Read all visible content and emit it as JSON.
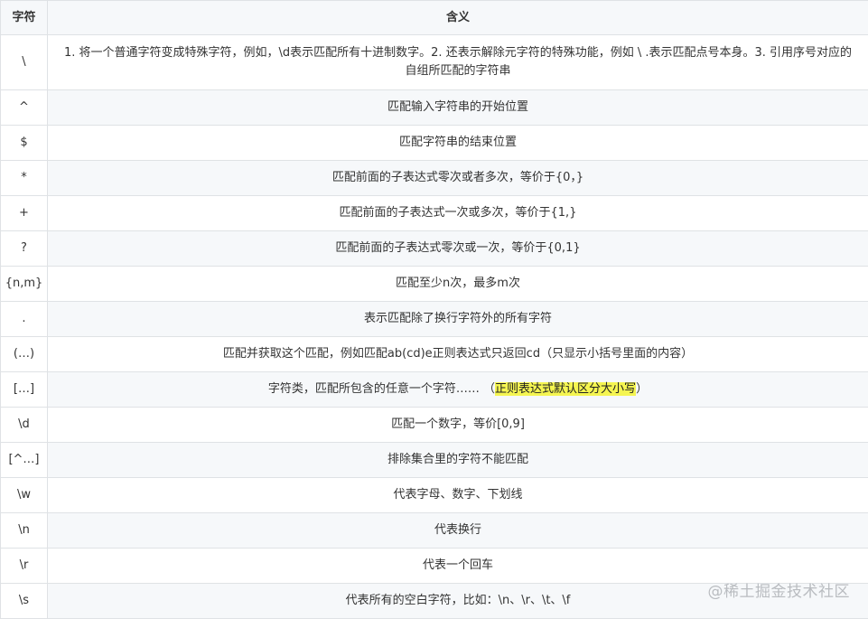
{
  "table": {
    "headers": [
      "字符",
      "含义"
    ],
    "rows": [
      {
        "char": "\\",
        "meaning": "1. 将一个普通字符变成特殊字符，例如，\\d表示匹配所有十进制数字。2. 还表示解除元字符的特殊功能，例如 \\ .表示匹配点号本身。3. 引用序号对应的自组所匹配的字符串",
        "highlight": ""
      },
      {
        "char": "^",
        "meaning": "匹配输入字符串的开始位置",
        "highlight": ""
      },
      {
        "char": "$",
        "meaning": "匹配字符串的结束位置",
        "highlight": ""
      },
      {
        "char": "*",
        "meaning": "匹配前面的子表达式零次或者多次，等价于{0，}",
        "highlight": ""
      },
      {
        "char": "+",
        "meaning": "匹配前面的子表达式一次或多次，等价于{1,}",
        "highlight": ""
      },
      {
        "char": "?",
        "meaning": "匹配前面的子表达式零次或一次，等价于{0,1}",
        "highlight": ""
      },
      {
        "char": "{n,m}",
        "meaning": "匹配至少n次，最多m次",
        "highlight": ""
      },
      {
        "char": ".",
        "meaning": "表示匹配除了换行字符外的所有字符",
        "highlight": ""
      },
      {
        "char": "(…)",
        "meaning": "匹配并获取这个匹配，例如匹配ab(cd)e正则表达式只返回cd（只显示小括号里面的内容）",
        "highlight": ""
      },
      {
        "char": "[…]",
        "meaning": "字符类，匹配所包含的任意一个字符…… （",
        "highlight": "正则表达式默认区分大小写",
        "meaning_after": "）"
      },
      {
        "char": "\\d",
        "meaning": "匹配一个数字，等价[0,9]",
        "highlight": ""
      },
      {
        "char": "[^…]",
        "meaning": "排除集合里的字符不能匹配",
        "highlight": ""
      },
      {
        "char": "\\w",
        "meaning": "代表字母、数字、下划线",
        "highlight": ""
      },
      {
        "char": "\\n",
        "meaning": "代表换行",
        "highlight": ""
      },
      {
        "char": "\\r",
        "meaning": "代表一个回车",
        "highlight": ""
      },
      {
        "char": "\\s",
        "meaning": "代表所有的空白字符，比如：\\n、\\r、\\t、\\f",
        "highlight": ""
      }
    ]
  },
  "watermark": "@稀土掘金技术社区"
}
